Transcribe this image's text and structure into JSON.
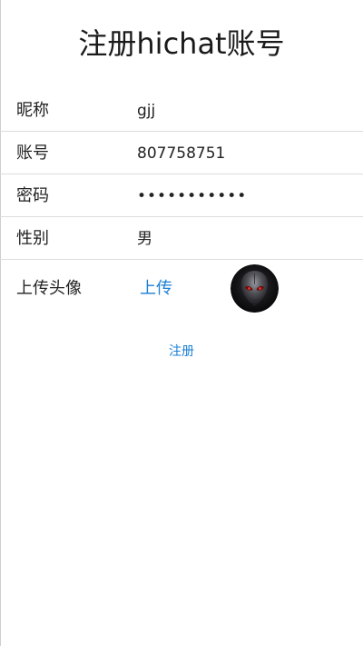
{
  "page": {
    "title": "注册hichat账号"
  },
  "form": {
    "nickname": {
      "label": "昵称",
      "value": "gjj"
    },
    "account": {
      "label": "账号",
      "value": "807758751"
    },
    "password": {
      "label": "密码",
      "value": "•••••••••••"
    },
    "gender": {
      "label": "性别",
      "value": "男"
    },
    "avatar": {
      "label": "上传头像",
      "upload_label": "上传",
      "icon": "alien-avatar-image"
    }
  },
  "actions": {
    "register_label": "注册"
  },
  "colors": {
    "accent": "#1a7fd4",
    "divider": "#dcdcdc",
    "text": "#222222"
  }
}
